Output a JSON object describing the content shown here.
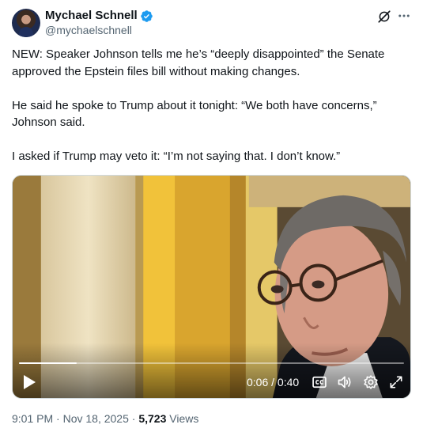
{
  "author": {
    "display_name": "Mychael Schnell",
    "handle": "@mychaelschnell",
    "verified": true,
    "verified_color": "#1d9bf0"
  },
  "header_actions": {
    "grok_icon": "grok-icon",
    "more_icon": "more-icon"
  },
  "tweet": {
    "paragraphs": [
      "NEW: Speaker Johnson tells me he’s “deeply disappointed” the Senate approved the Epstein files bill without making changes.",
      "He said he spoke to Trump about it tonight: “We both have concerns,” Johnson said.",
      "I asked if Trump may veto it: “I’m not saying that. I don’t know.”"
    ]
  },
  "video": {
    "current_time": "0:06",
    "duration": "0:40",
    "time_display": "0:06 / 0:40",
    "progress": 0.15,
    "controls": [
      "play-icon",
      "captions-icon",
      "volume-icon",
      "settings-icon",
      "fullscreen-icon"
    ]
  },
  "meta": {
    "time": "9:01 PM",
    "separator": " · ",
    "date": "Nov 18, 2025",
    "views_count": "5,723",
    "views_label": "Views"
  }
}
